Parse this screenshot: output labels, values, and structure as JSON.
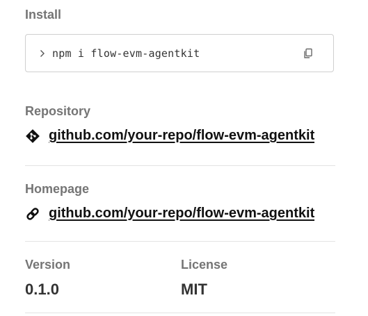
{
  "install": {
    "label": "Install",
    "command": "npm i flow-evm-agentkit",
    "prompt_icon": "chevron-right-icon",
    "copy_icon": "copy-icon"
  },
  "repository": {
    "label": "Repository",
    "link_text": "github.com/your-repo/flow-evm-agentkit",
    "icon": "git-diamond-icon"
  },
  "homepage": {
    "label": "Homepage",
    "link_text": "github.com/your-repo/flow-evm-agentkit",
    "icon": "link-icon"
  },
  "version": {
    "label": "Version",
    "value": "0.1.0"
  },
  "license": {
    "label": "License",
    "value": "MIT"
  }
}
